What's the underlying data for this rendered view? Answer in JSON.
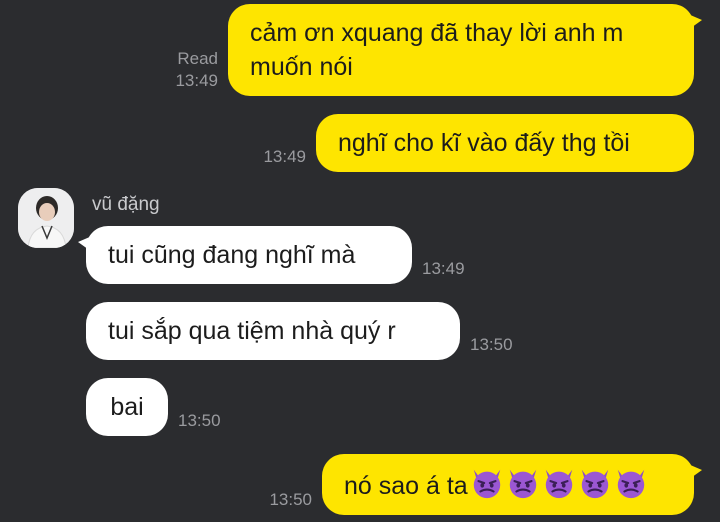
{
  "conversation": {
    "contact": {
      "name": "vũ đặng",
      "avatar_icon": "profile-photo"
    },
    "colors": {
      "background": "#2b2c2f",
      "outgoing_bubble": "#fee500",
      "incoming_bubble": "#ffffff",
      "meta_text": "#9a9b9f"
    },
    "messages": [
      {
        "direction": "out",
        "text": "cảm ơn xquang đã thay lời anh m muốn nói",
        "status": "Read",
        "time": "13:49"
      },
      {
        "direction": "out",
        "text": "nghĩ cho kĩ vào đấy thg tồi",
        "time": "13:49"
      },
      {
        "direction": "in",
        "text": "tui cũng đang nghĩ mà",
        "time": "13:49"
      },
      {
        "direction": "in",
        "text": "tui sắp qua tiệm nhà quý r",
        "time": "13:50"
      },
      {
        "direction": "in",
        "text": "bai",
        "time": "13:50"
      },
      {
        "direction": "out",
        "text": "nó sao á ta",
        "emoji": "smiling-face-with-horns",
        "emoji_count": 5,
        "time": "13:50"
      }
    ]
  }
}
